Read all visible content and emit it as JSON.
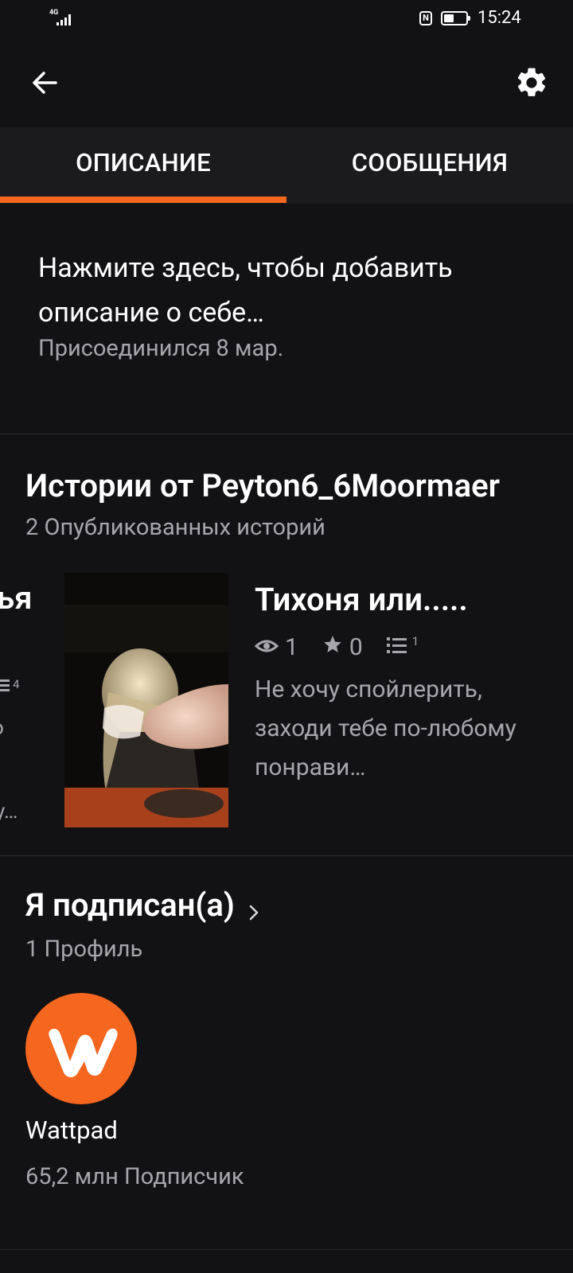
{
  "status_bar": {
    "network": "4G",
    "time": "15:24"
  },
  "tabs": [
    {
      "label": "ОПИСАНИЕ",
      "active": true
    },
    {
      "label": "СООБЩЕНИЯ",
      "active": false
    }
  ],
  "description": {
    "prompt": "Нажмите здесь, чтобы добавить описание о себе…",
    "joined": "Присоединился 8 мар."
  },
  "stories": {
    "title": "Истории от Peyton6_6Moormaer",
    "count": "2 Опубликованных историй",
    "prev_fragment": {
      "title_tail": "ья",
      "parts": "4",
      "text_tail_1": "о",
      "text_tail_2": "у…"
    },
    "current": {
      "title": "Тихоня или.....",
      "reads": "1",
      "votes": "0",
      "parts": "1",
      "blurb": "Не хочу спойлерить, заходи тебе по-любому понрави…"
    }
  },
  "following": {
    "title": "Я подписан(а)",
    "count": "1 Профиль",
    "profiles": [
      {
        "name": "Wattpad",
        "followers": "65,2 млн Подписчик"
      }
    ]
  },
  "colors": {
    "accent": "#f5661e",
    "background": "#121114",
    "tab_bar": "#1b1a1d",
    "secondary_text": "#a7a6ab"
  },
  "icons": [
    "back-arrow-icon",
    "settings-gear-icon",
    "eye-icon",
    "star-icon",
    "list-icon",
    "chevron-right-icon",
    "wattpad-logo-icon"
  ]
}
